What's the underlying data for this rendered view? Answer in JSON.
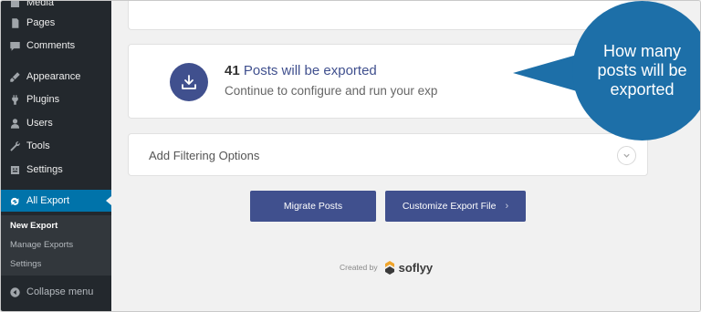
{
  "sidebar": {
    "items": [
      {
        "label": "Media",
        "icon": "media-icon"
      },
      {
        "label": "Pages",
        "icon": "pages-icon"
      },
      {
        "label": "Comments",
        "icon": "comments-icon"
      },
      {
        "label": "Appearance",
        "icon": "appearance-icon"
      },
      {
        "label": "Plugins",
        "icon": "plugins-icon"
      },
      {
        "label": "Users",
        "icon": "users-icon"
      },
      {
        "label": "Tools",
        "icon": "tools-icon"
      },
      {
        "label": "Settings",
        "icon": "settings-icon"
      },
      {
        "label": "All Export",
        "icon": "all-export-icon"
      }
    ],
    "submenu": [
      "New Export",
      "Manage Exports",
      "Settings"
    ],
    "collapse_label": "Collapse menu"
  },
  "export": {
    "count": "41",
    "title_rest": "Posts will be exported",
    "subtitle": "Continue to configure and run your exp"
  },
  "filter": {
    "label": "Add Filtering Options"
  },
  "buttons": {
    "migrate": "Migrate Posts",
    "customize": "Customize Export File"
  },
  "credit": {
    "created_by": "Created by",
    "brand": "soflyy"
  },
  "callout": {
    "text": "How many posts will be exported"
  },
  "colors": {
    "accent": "#40508e",
    "wp_blue": "#0073aa",
    "callout": "#1d6fa8",
    "sidebar": "#23282d"
  }
}
